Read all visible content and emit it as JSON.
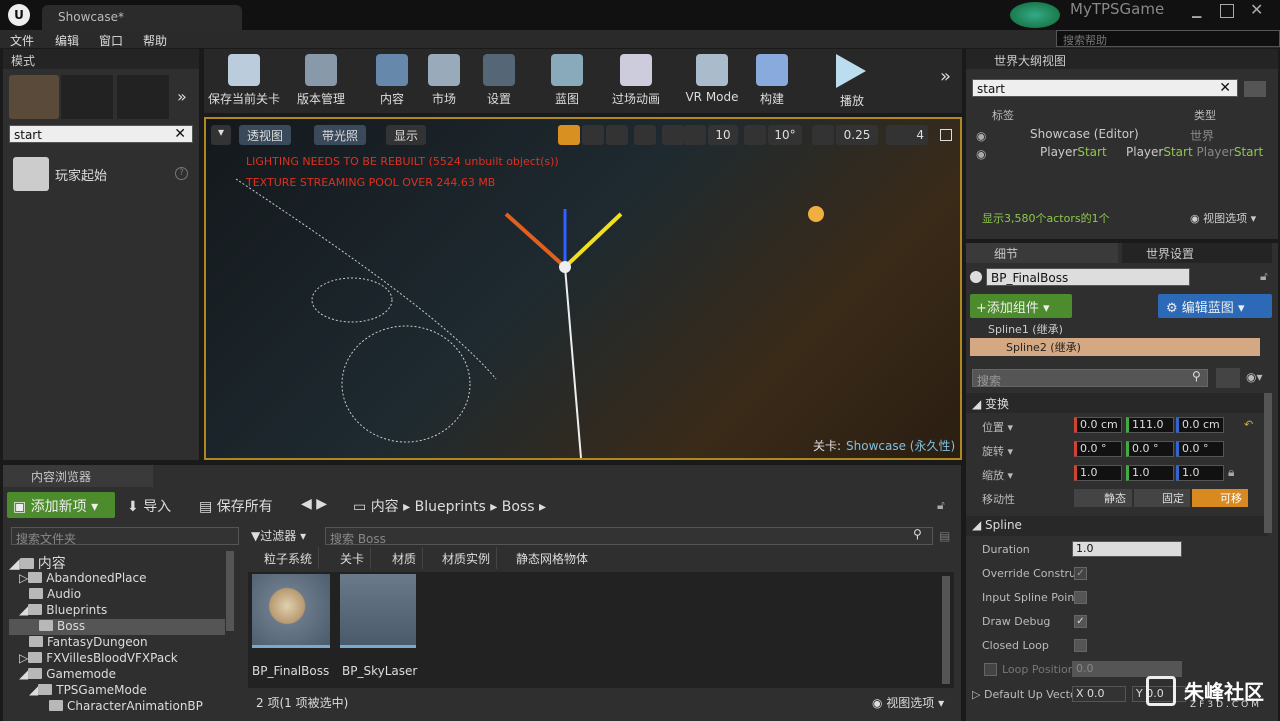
{
  "window": {
    "tab_title": "Showcase*",
    "project": "MyTPSGame",
    "help_search_placeholder": "搜索帮助"
  },
  "menu": [
    "文件",
    "编辑",
    "窗口",
    "帮助"
  ],
  "modes": {
    "title": "模式",
    "search_value": "start",
    "item": "玩家起始"
  },
  "toolbar": [
    "保存当前关卡",
    "版本管理",
    "内容",
    "市场",
    "设置",
    "蓝图",
    "过场动画",
    "VR Mode",
    "构建",
    "播放"
  ],
  "viewport": {
    "view_buttons": [
      "透视图",
      "带光照",
      "显示"
    ],
    "grid_value": "10",
    "rotation_value": "10°",
    "scale_value": "0.25",
    "camera_speed": "4",
    "warning1": "LIGHTING NEEDS TO BE REBUILT (5524 unbuilt object(s))",
    "warning2": "TEXTURE STREAMING POOL OVER 244.63 MB",
    "level_label": "关卡:",
    "level_name": "Showcase (永久性)"
  },
  "outliner": {
    "title": "世界大纲视图",
    "search_value": "start",
    "col_label": "标签",
    "col_type": "类型",
    "rows": [
      {
        "label": "Showcase (Editor)",
        "type": "世界"
      },
      {
        "label_a": "Player",
        "label_b": "Start",
        "type_a": "Player",
        "type_b": "Start",
        "type_c": "Player",
        "type_d": "Start"
      }
    ],
    "status": "显示3,580个actors的1个",
    "view_options": "视图选项"
  },
  "details": {
    "tab": "细节",
    "world_tab": "世界设置",
    "object_name": "BP_FinalBoss",
    "add_component": "添加组件",
    "edit_blueprint": "编辑蓝图",
    "components": [
      "Spline1 (继承)",
      "Spline2 (继承)"
    ],
    "search_placeholder": "搜索",
    "transform_title": "变换",
    "location_label": "位置",
    "rotation_label": "旋转",
    "scale_label": "缩放",
    "mobility_label": "移动性",
    "location": [
      "0.0 cm",
      "111.0",
      "0.0 cm"
    ],
    "rotation": [
      "0.0 °",
      "0.0 °",
      "0.0 °"
    ],
    "scale": [
      "1.0",
      "1.0",
      "1.0"
    ],
    "mobility": [
      "静态",
      "固定",
      "可移"
    ],
    "spline_title": "Spline",
    "duration_label": "Duration",
    "duration_value": "1.0",
    "props": [
      "Override Constru",
      "Input Spline Poin",
      "Draw Debug",
      "Closed Loop",
      "Loop Position"
    ],
    "loop_value": "0.0",
    "default_up": "Default Up Vecto",
    "up_x_label": "X",
    "up_x_value": "0.0",
    "up_y_label": "Y",
    "up_y_value": "0.0"
  },
  "content_browser": {
    "title": "内容浏览器",
    "add_new": "添加新项",
    "import": "导入",
    "save_all": "保存所有",
    "breadcrumb": [
      "内容",
      "Blueprints",
      "Boss"
    ],
    "folder_search_placeholder": "搜索文件夹",
    "filter": "过滤器",
    "asset_search_placeholder": "搜索 Boss",
    "filter_tabs": [
      "粒子系统",
      "关卡",
      "材质",
      "材质实例",
      "静态网格物体"
    ],
    "root": "内容",
    "folders": [
      "AbandonedPlace",
      "Audio",
      "Blueprints",
      "Boss",
      "FantasyDungeon",
      "FXVillesBloodVFXPack",
      "Gamemode",
      "TPSGameMode",
      "CharacterAnimationBP"
    ],
    "assets": [
      "BP_FinalBoss",
      "BP_SkyLaser"
    ],
    "status": "2 项(1 项被选中)",
    "view_options": "视图选项"
  },
  "watermark": {
    "text": "朱峰社区",
    "url": "ZF3D.COM"
  }
}
